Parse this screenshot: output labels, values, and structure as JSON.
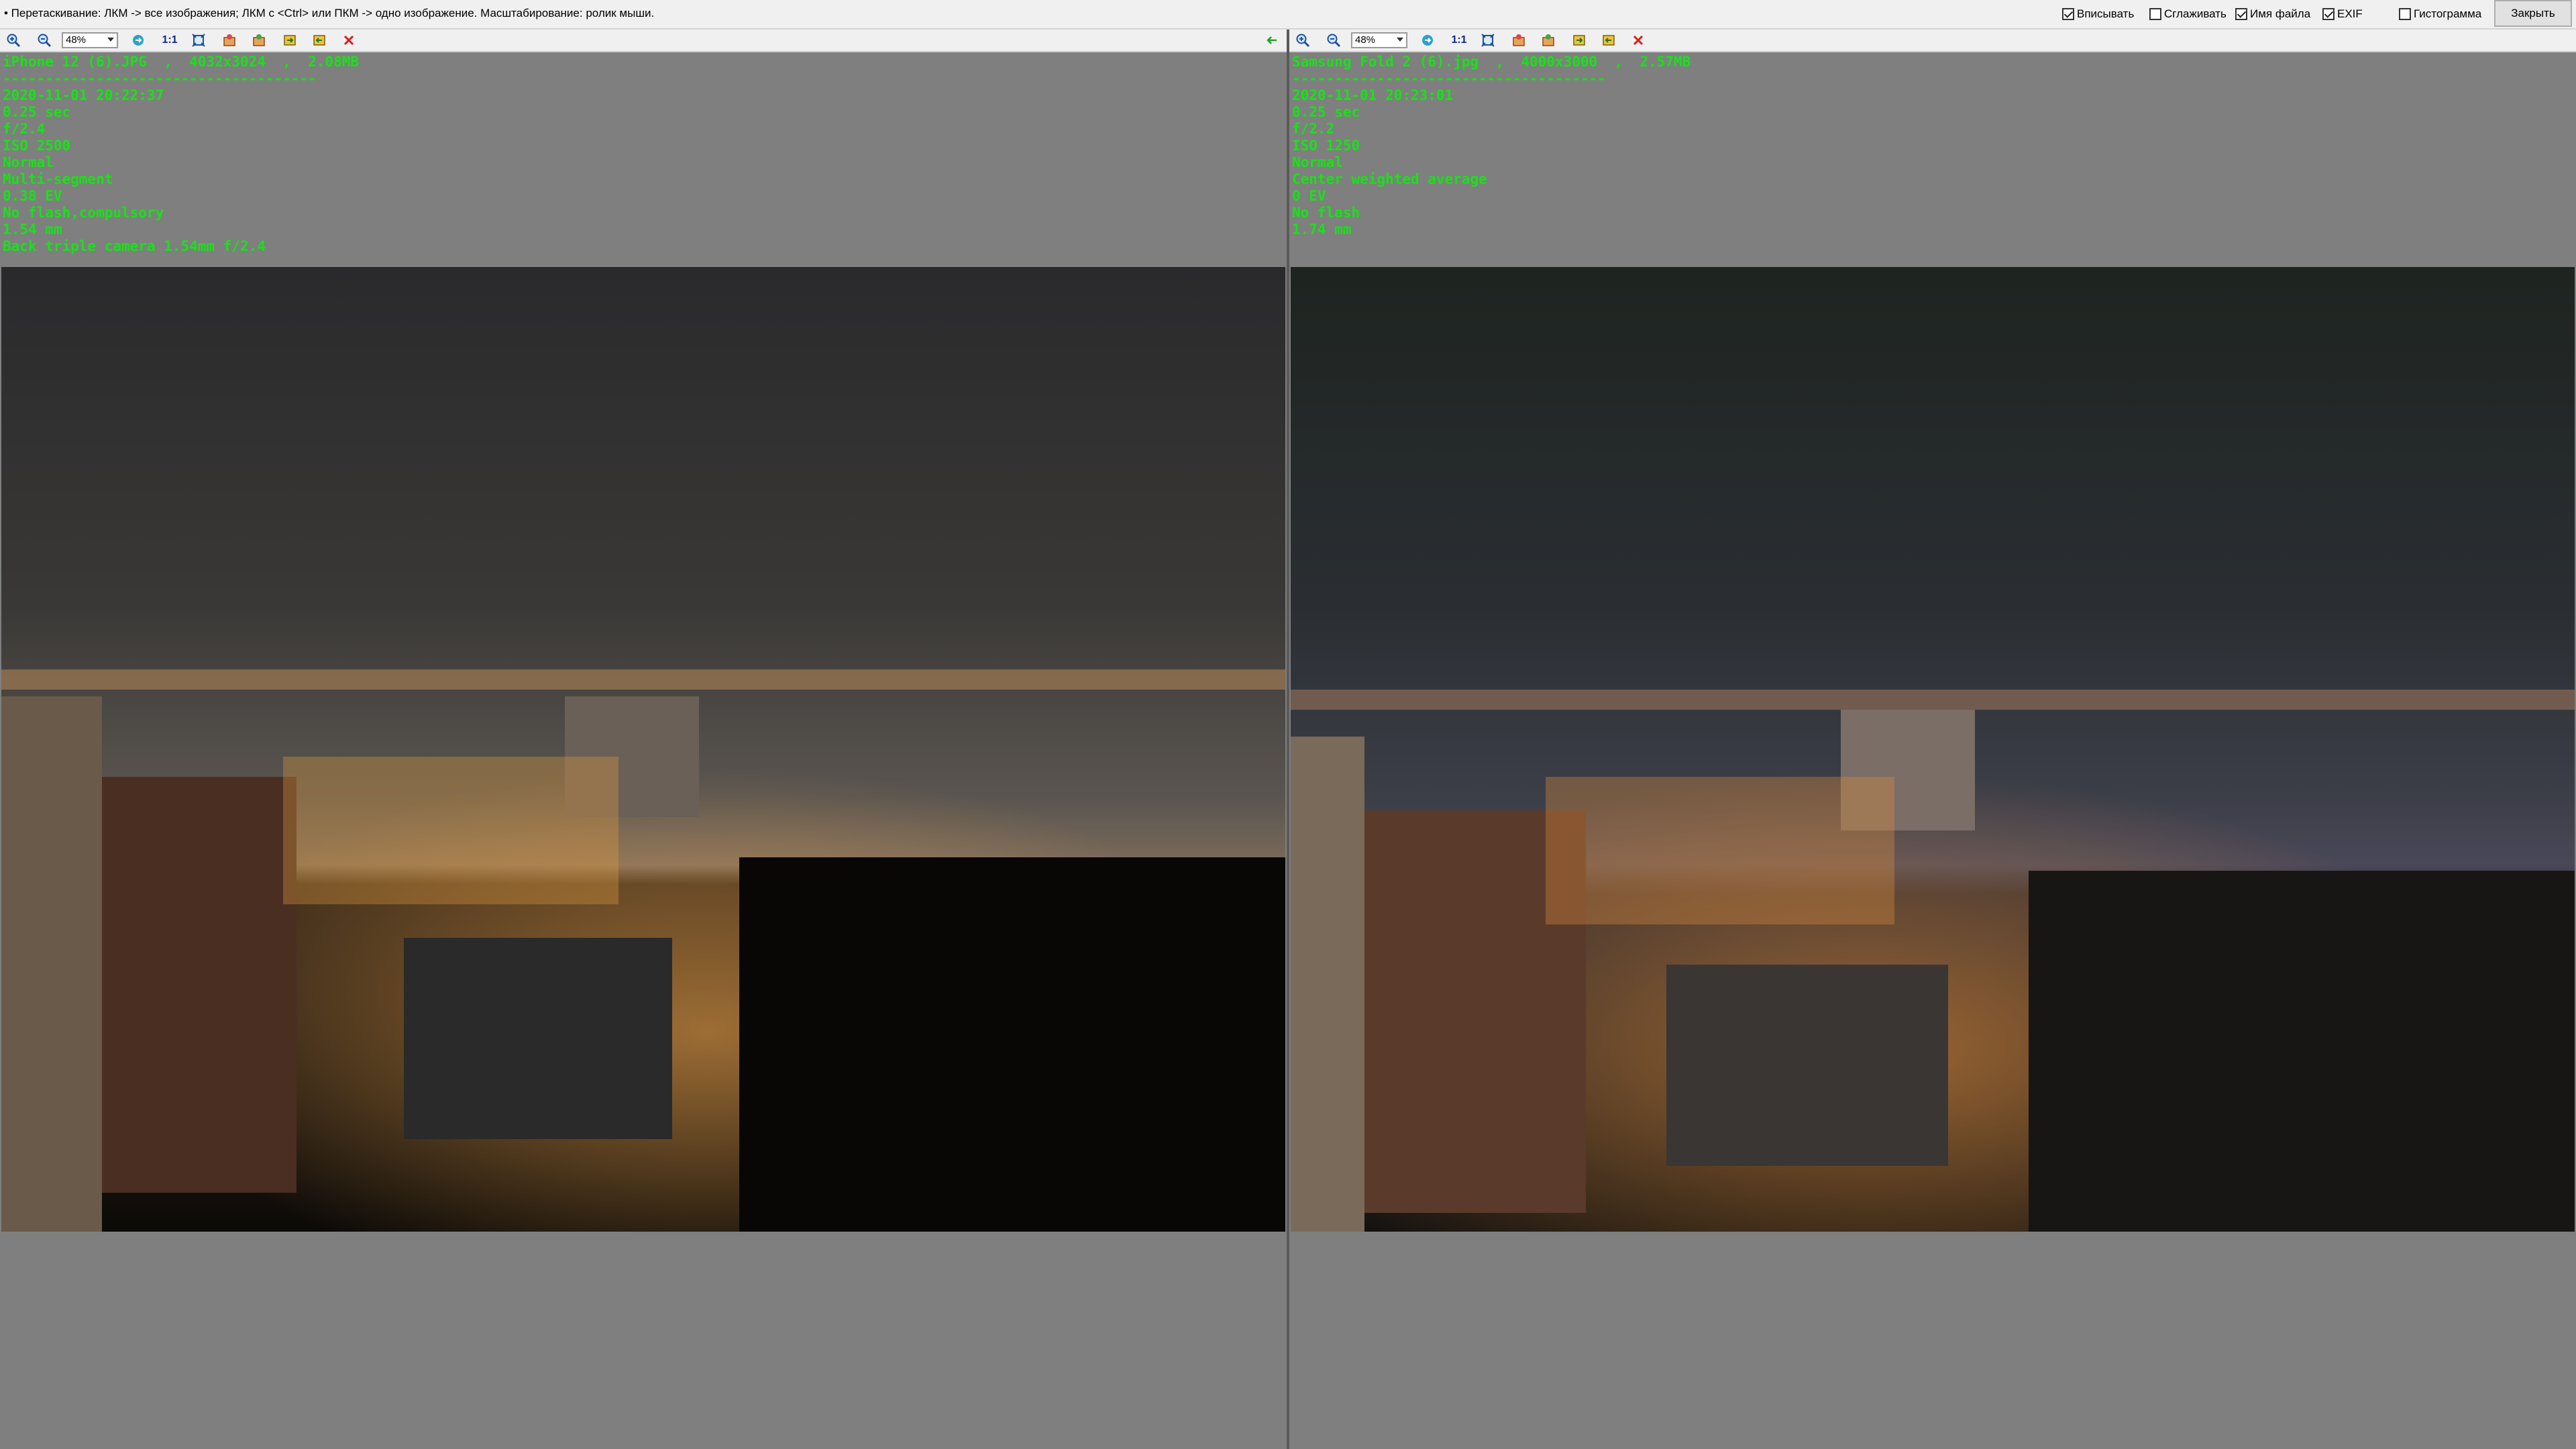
{
  "topbar": {
    "hint": "• Перетаскивание: ЛКМ -> все изображения; ЛКМ с <Ctrl> или ПКМ -> одно изображение. Масштабирование: ролик мыши.",
    "options": [
      {
        "label": "Вписывать",
        "checked": true
      },
      {
        "label": "Сглаживать",
        "checked": false
      },
      {
        "label": "Имя файла",
        "checked": true
      },
      {
        "label": "EXIF",
        "checked": true
      },
      {
        "label": "Гистограмма",
        "checked": false
      }
    ],
    "close_label": "Закрыть"
  },
  "panes": [
    {
      "zoom": "48%",
      "one_to_one": "1:1",
      "info": {
        "title": "iPhone 12 (6).JPG  ,  4032x3024  ,  2.08MB",
        "separator": "-------------------------------------",
        "lines": [
          "2020-11-01 20:22:37",
          "0.25 sec",
          "f/2.4",
          "ISO 2500",
          "Normal",
          "Multi-segment",
          "0.38 EV",
          "No flash,compulsory",
          "1.54 mm",
          "Back triple camera 1.54mm f/2.4"
        ]
      }
    },
    {
      "zoom": "48%",
      "one_to_one": "1:1",
      "info": {
        "title": "Samsung Fold 2 (6).jpg  ,  4000x3000  ,  2.57MB",
        "separator": "-------------------------------------",
        "lines": [
          "2020-11-01 20:23:01",
          "0.25 sec",
          "f/2.2",
          "ISO 1250",
          "Normal",
          "Center weighted average",
          "0 EV",
          "No flash",
          "1.74 mm"
        ]
      }
    }
  ],
  "icons": {
    "zoom_in": "zoom-in-icon",
    "zoom_out": "zoom-out-icon",
    "sync": "sync-icon",
    "fit": "fit-window-icon",
    "rotate_left": "rotate-left-icon",
    "rotate_right": "rotate-right-icon",
    "save": "save-icon",
    "export": "export-icon",
    "close": "close-icon",
    "back": "arrow-left-icon"
  },
  "colors": {
    "overlay_text": "#17e317",
    "background": "#808080"
  }
}
